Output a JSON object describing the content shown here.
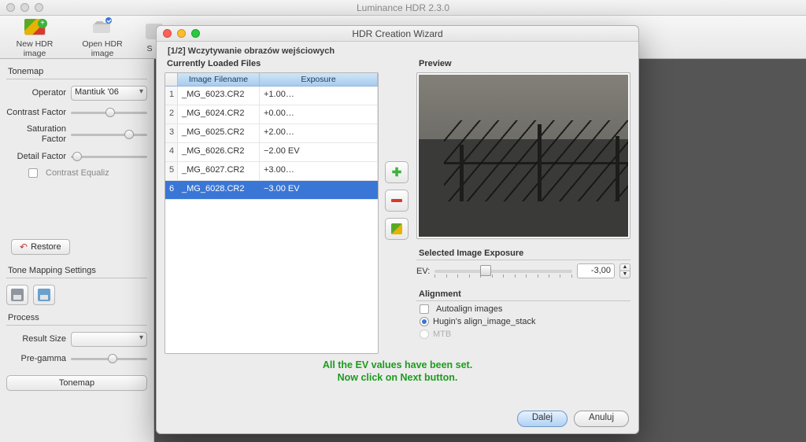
{
  "app": {
    "title": "Luminance HDR 2.3.0"
  },
  "toolbar": {
    "new": "New HDR image",
    "open": "Open HDR image",
    "item3": "S"
  },
  "tonemap": {
    "group": "Tonemap",
    "operator_lbl": "Operator",
    "operator_val": "Mantiuk '06",
    "contrast_lbl": "Contrast Factor",
    "saturation_lbl": "Saturation Factor",
    "detail_lbl": "Detail Factor",
    "equaliz": "Contrast Equaliz",
    "restore": "Restore",
    "settings": "Tone Mapping Settings",
    "process": "Process",
    "result_lbl": "Result Size",
    "pregamma_lbl": "Pre-gamma",
    "tonemap_btn": "Tonemap"
  },
  "wizard": {
    "title": "HDR Creation Wizard",
    "step": "[1/2] Wczytywanie obrazów wejściowych",
    "loaded": "Currently Loaded Files",
    "col_file": "Image Filename",
    "col_exp": "Exposure",
    "rows": [
      {
        "n": "1",
        "f": "_MG_6023.CR2",
        "e": "+1.00…"
      },
      {
        "n": "2",
        "f": "_MG_6024.CR2",
        "e": "+0.00…"
      },
      {
        "n": "3",
        "f": "_MG_6025.CR2",
        "e": "+2.00…"
      },
      {
        "n": "4",
        "f": "_MG_6026.CR2",
        "e": "−2.00 EV"
      },
      {
        "n": "5",
        "f": "_MG_6027.CR2",
        "e": "+3.00…"
      },
      {
        "n": "6",
        "f": "_MG_6028.CR2",
        "e": "−3.00 EV"
      }
    ],
    "preview": "Preview",
    "exposure_head": "Selected Image Exposure",
    "ev_lbl": "EV:",
    "ev_val": "-3,00",
    "align_head": "Alignment",
    "autoalign": "Autoalign images",
    "hugin": "Hugin's align_image_stack",
    "mtb": "MTB",
    "msg1": "All the EV values have been set.",
    "msg2": "Now click on Next button.",
    "next": "Dalej",
    "cancel": "Anuluj"
  }
}
